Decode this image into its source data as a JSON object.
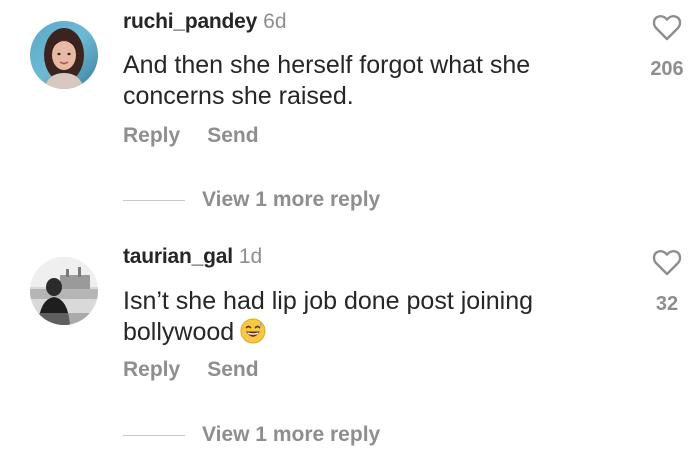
{
  "comments": [
    {
      "username": "ruchi_pandey",
      "time": "6d",
      "text": "And then she herself forgot what she concerns she raised.",
      "reply_label": "Reply",
      "send_label": "Send",
      "view_more_label": "View 1 more reply",
      "likes": "206",
      "avatar_icon": "avatar-woman-icon"
    },
    {
      "username": "taurian_gal",
      "time": "1d",
      "text": "Isn’t she had lip job done post joining bollywood",
      "emoji": "grinning-sweat-emoji",
      "reply_label": "Reply",
      "send_label": "Send",
      "view_more_label": "View 1 more reply",
      "likes": "32",
      "avatar_icon": "avatar-bw-photo-icon"
    }
  ],
  "colors": {
    "text_primary": "#262626",
    "text_secondary": "#8e8e8e",
    "divider": "#c7c7c7"
  }
}
